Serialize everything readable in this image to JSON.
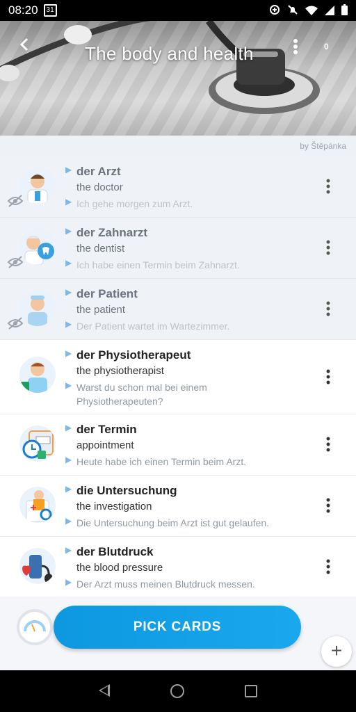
{
  "status_bar": {
    "time": "08:20",
    "calendar_day": "31",
    "icons": [
      "data-saver-icon",
      "notifications-off-icon",
      "wifi-icon",
      "signal-icon",
      "battery-icon"
    ]
  },
  "header": {
    "title": "The body and health",
    "count": "0",
    "icons": [
      "back-arrow-icon",
      "more-vert-icon"
    ]
  },
  "byline": "by Štěpánka",
  "cards": [
    {
      "word": "der Arzt",
      "translation": "the doctor",
      "example": "Ich gehe morgen zum Arzt.",
      "state": "hidden",
      "icon": "doctor-avatar-icon"
    },
    {
      "word": "der Zahnarzt",
      "translation": "the dentist",
      "example": "Ich habe einen Termin beim Zahnarzt.",
      "state": "hidden",
      "icon": "dentist-avatar-icon"
    },
    {
      "word": "der Patient",
      "translation": "the patient",
      "example": "Der Patient wartet im Wartezimmer.",
      "state": "hidden",
      "icon": "patient-avatar-icon"
    },
    {
      "word": "der Physiotherapeut",
      "translation": "the physiotherapist",
      "example": "Warst du schon mal bei einem Physiotherapeuten?",
      "state": "visible",
      "icon": "physiotherapist-avatar-icon"
    },
    {
      "word": "der Termin",
      "translation": "appointment",
      "example": "Heute habe ich einen Termin beim Arzt.",
      "state": "visible",
      "icon": "appointment-calendar-icon"
    },
    {
      "word": "die Untersuchung",
      "translation": "the investigation",
      "example": "Die Untersuchung beim Arzt ist gut gelaufen.",
      "state": "visible",
      "icon": "examination-icon"
    },
    {
      "word": "der Blutdruck",
      "translation": "the blood pressure",
      "example": "Der Arzt muss meinen Blutdruck messen.",
      "state": "visible",
      "icon": "blood-pressure-icon"
    }
  ],
  "bottom": {
    "pick_cards_label": "PICK CARDS",
    "add_label": "+"
  },
  "colors": {
    "accent": "#1aa3e8",
    "triangle": "#7fb8e8"
  }
}
